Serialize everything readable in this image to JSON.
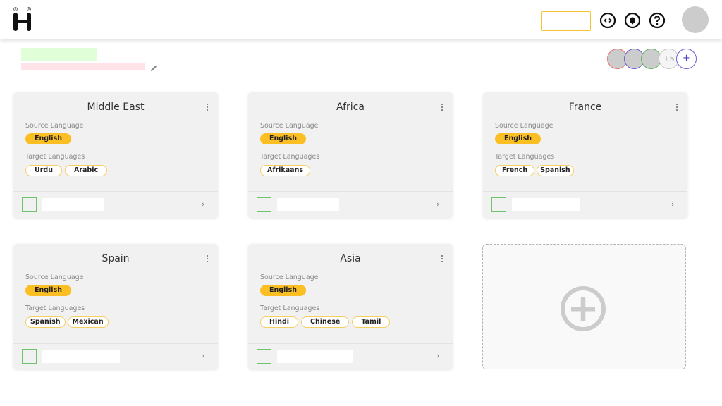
{
  "header": {
    "logo_icon": "h-logo-icon",
    "search_value": "",
    "icons": [
      "code-icon",
      "bell-icon",
      "help-icon"
    ],
    "user_avatar": "user-avatar"
  },
  "project": {
    "title": "",
    "subtitle": "",
    "edit_icon": "pencil-icon",
    "members": [
      {
        "border_color": "#e57373"
      },
      {
        "border_color": "#6b5fd1"
      },
      {
        "border_color": "#5cb85c"
      }
    ],
    "more_members_label": "+5",
    "add_member_label": "+"
  },
  "labels": {
    "source_language": "Source Language",
    "target_languages": "Target Languages"
  },
  "colors": {
    "accent_yellow": "#fbbf24",
    "chip_border": "#f5cf5f",
    "thumb_green": "#6fc36a",
    "search_border": "#f7c332"
  },
  "cards": [
    {
      "title": "Middle East",
      "source": "English",
      "targets": [
        "Urdu",
        "Arabic"
      ]
    },
    {
      "title": "Africa",
      "source": "English",
      "targets": [
        "Afrikaans"
      ]
    },
    {
      "title": "France",
      "source": "English",
      "targets": [
        "French",
        "Spanish"
      ]
    },
    {
      "title": "Spain",
      "source": "English",
      "targets": [
        "Spanish",
        "Mexican"
      ]
    },
    {
      "title": "Asia",
      "source": "English",
      "targets": [
        "Hindi",
        "Chinese",
        "Tamil"
      ]
    }
  ],
  "add_card": {
    "icon": "add-circle-icon"
  }
}
